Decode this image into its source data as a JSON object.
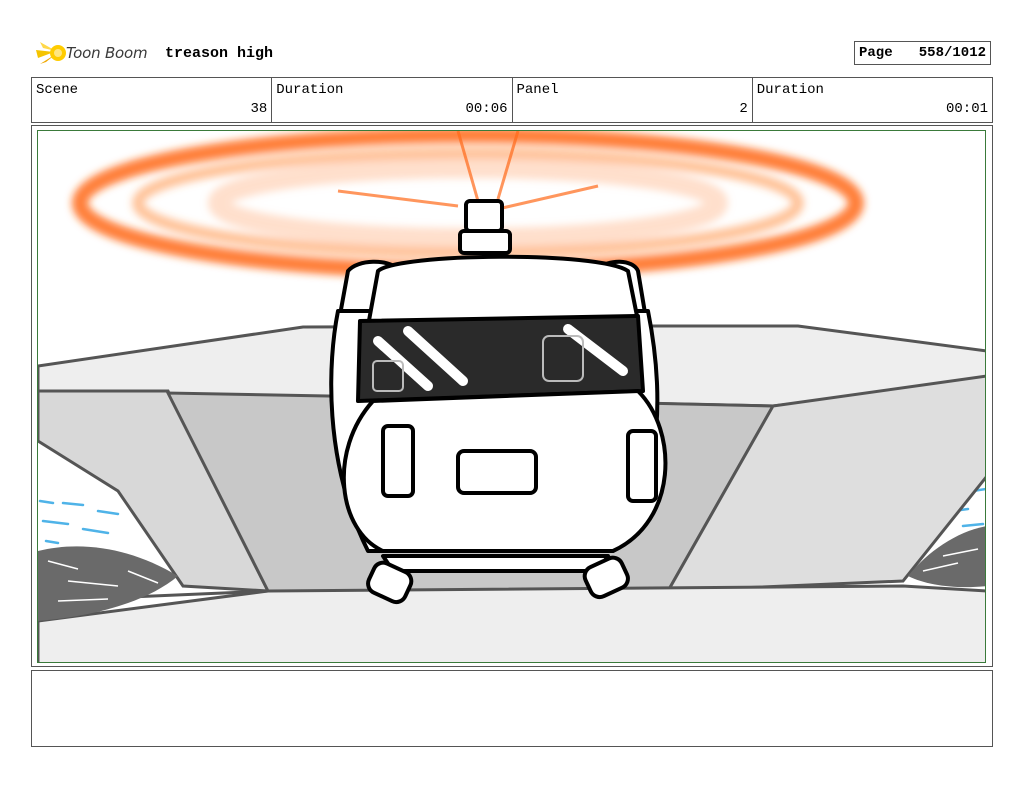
{
  "header": {
    "logo_text": "Toon Boom",
    "project_title": "treason high",
    "page_label": "Page",
    "page_value": "558/1012"
  },
  "info": [
    {
      "label": "Scene",
      "value": "38"
    },
    {
      "label": "Duration",
      "value": "00:06"
    },
    {
      "label": "Panel",
      "value": "2"
    },
    {
      "label": "Duration",
      "value": "00:01"
    }
  ],
  "panel": {
    "image": "storyboard-sketch-helicopter-front-view",
    "rotor_color": "#ff6a1a",
    "frame_color": "#3a7a3a"
  },
  "notes": {
    "text": ""
  }
}
